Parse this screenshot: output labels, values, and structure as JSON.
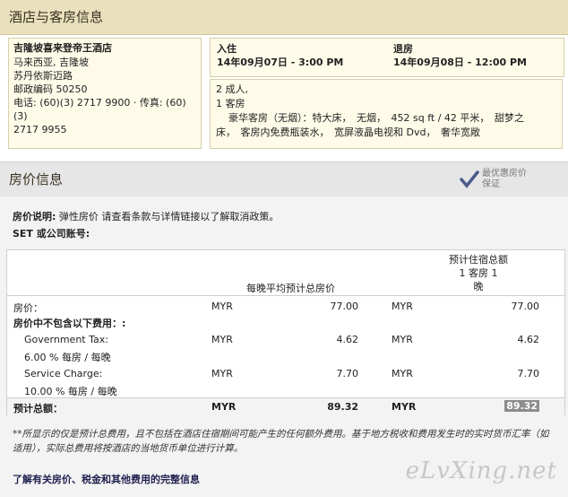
{
  "hotel_section": {
    "title": "酒店与客房信息",
    "hotel": {
      "name": "吉隆坡喜来登帝王酒店",
      "address_lines": [
        "马来西亚, 吉隆坡",
        "苏丹依斯迈路",
        "邮政编码 50250",
        "电话: (60)(3) 2717 9900 · 传真: (60)(3)",
        "2717 9955"
      ]
    },
    "checkin_label": "入住",
    "checkin_value": "14年09月07日 - 3:00 PM",
    "checkout_label": "退房",
    "checkout_value": "14年09月08日 - 12:00 PM",
    "guests": "2 成人,",
    "rooms": "1 客房",
    "room_desc_1": "豪华客房（无烟）：特大床，　无烟，　452 sq ft / 42 平米，　甜梦之",
    "room_desc_2": "床，　客房内免费瓶装水，　宽屏液晶电视和 Dvd，　奢华宽敞"
  },
  "rate_section": {
    "title": "房价信息",
    "badge_line1": "最优惠房价",
    "badge_line2": "保证",
    "policy_label": "房价说明:",
    "policy_text": " 弹性房价 请查看条款与详情链接以了解取消政策。",
    "account_label": "SET 或公司账号:",
    "col_avg_label": "每晚平均预计总房价",
    "col_total_label_1": "预计住宿总额",
    "col_total_label_2": "1 客房 1",
    "col_total_label_3": "晚",
    "rows": {
      "rate": {
        "label": "房价：",
        "cur1": "MYR",
        "val1": "77.00",
        "cur2": "MYR",
        "val2": "77.00"
      },
      "excluded_label": "房价中不包含以下费用：:",
      "tax": {
        "label": "Government Tax:",
        "sub": "6.00 % 每房 / 每晚",
        "cur1": "MYR",
        "val1": "4.62",
        "cur2": "MYR",
        "val2": "4.62"
      },
      "service": {
        "label": "Service Charge:",
        "sub": "10.00 % 每房 / 每晚",
        "cur1": "MYR",
        "val1": "7.70",
        "cur2": "MYR",
        "val2": "7.70"
      },
      "total": {
        "label": "预计总额：",
        "cur1": "MYR",
        "val1": "89.32",
        "cur2": "MYR",
        "val2": "89.32"
      }
    },
    "note": "**所显示的仅是预计总费用，且不包括在酒店住宿期间可能产生的任何额外费用。基于地方税收和费用发生时的实时货币汇率（如适用），实际总费用将按酒店的当地货币单位进行计算。",
    "link_text": "了解有关房价、税金和其他费用的完整信息",
    "watermark": "eLvXing.net"
  }
}
